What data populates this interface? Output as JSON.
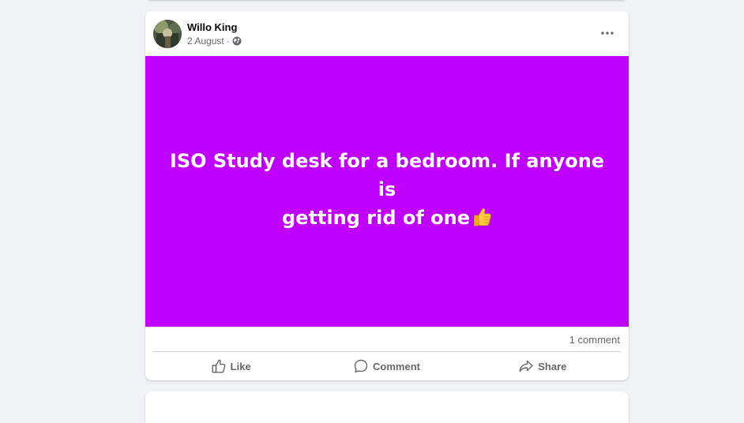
{
  "post": {
    "author": "Willo King",
    "date": "2 August",
    "separator": "·",
    "privacy_icon": "globe-icon",
    "menu_icon": "more-options-icon",
    "text_line_1": "ISO Study desk for a bedroom. If anyone is",
    "text_line_2": "getting rid of one",
    "emoji": "thumbs-up-icon",
    "background_color": "#c000ff",
    "comment_count": "1 comment"
  },
  "actions": {
    "like_label": "Like",
    "comment_label": "Comment",
    "share_label": "Share",
    "like_icon": "thumbs-up-outline-icon",
    "comment_icon": "speech-bubble-icon",
    "share_icon": "share-arrow-icon"
  },
  "colors": {
    "page_background": "#f0f2f5",
    "card_background": "#ffffff",
    "primary_text": "#050505",
    "secondary_text": "#65676b",
    "post_background": "#c000ff"
  }
}
